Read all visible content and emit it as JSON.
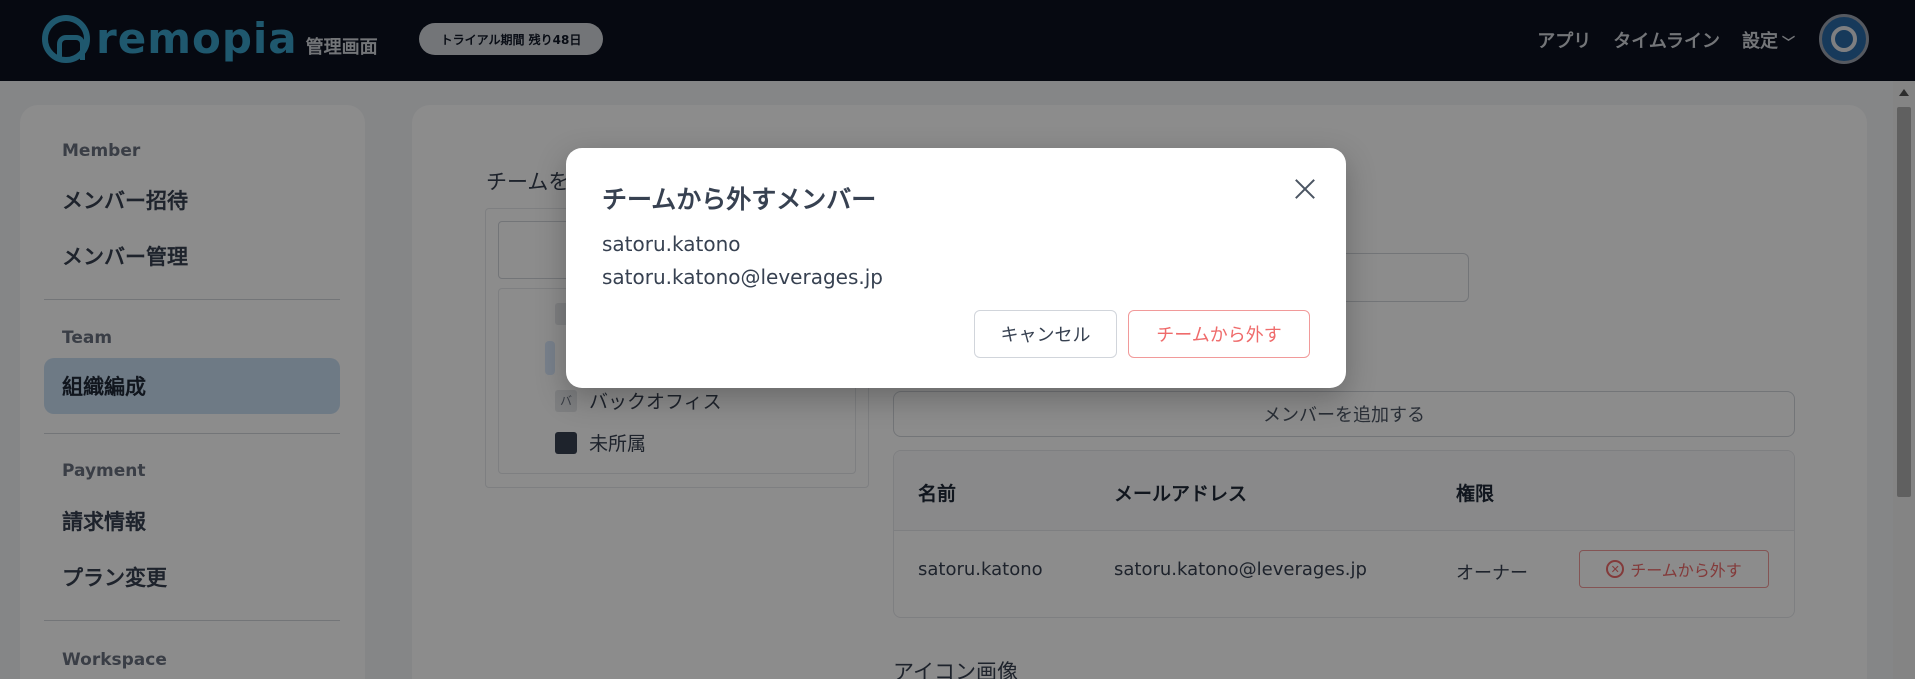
{
  "header": {
    "logo_text": "remopia",
    "logo_sub": "管理画面",
    "trial_badge": "トライアル期間 残り48日",
    "nav": [
      "アプリ",
      "タイムライン",
      "設定"
    ]
  },
  "sidebar": {
    "sections": [
      {
        "title": "Member",
        "items": [
          "メンバー招待",
          "メンバー管理"
        ]
      },
      {
        "title": "Team",
        "items": [
          "組織編成"
        ]
      },
      {
        "title": "Payment",
        "items": [
          "請求情報",
          "プラン変更"
        ]
      },
      {
        "title": "Workspace",
        "items": []
      }
    ],
    "active_item": "組織編成"
  },
  "main": {
    "team_label": "チームを",
    "tree_items": [
      "バックオフィス",
      "未所属"
    ],
    "tree_icons": [
      "バ",
      ""
    ],
    "add_member_button": "メンバーを追加する",
    "table": {
      "headers": [
        "名前",
        "メールアドレス",
        "権限"
      ],
      "rows": [
        {
          "name": "satoru.katono",
          "email": "satoru.katono@leverages.jp",
          "role": "オーナー",
          "action": "チームから外す"
        }
      ]
    },
    "icon_section_label": "アイコン画像"
  },
  "modal": {
    "title": "チームから外すメンバー",
    "member_name": "satoru.katono",
    "member_email": "satoru.katono@leverages.jp",
    "cancel_label": "キャンセル",
    "confirm_label": "チームから外す"
  },
  "colors": {
    "header_bg": "#0b1120",
    "brand": "#3aa0c8",
    "danger": "#ef6b6b",
    "active_bg": "#c9def2"
  }
}
